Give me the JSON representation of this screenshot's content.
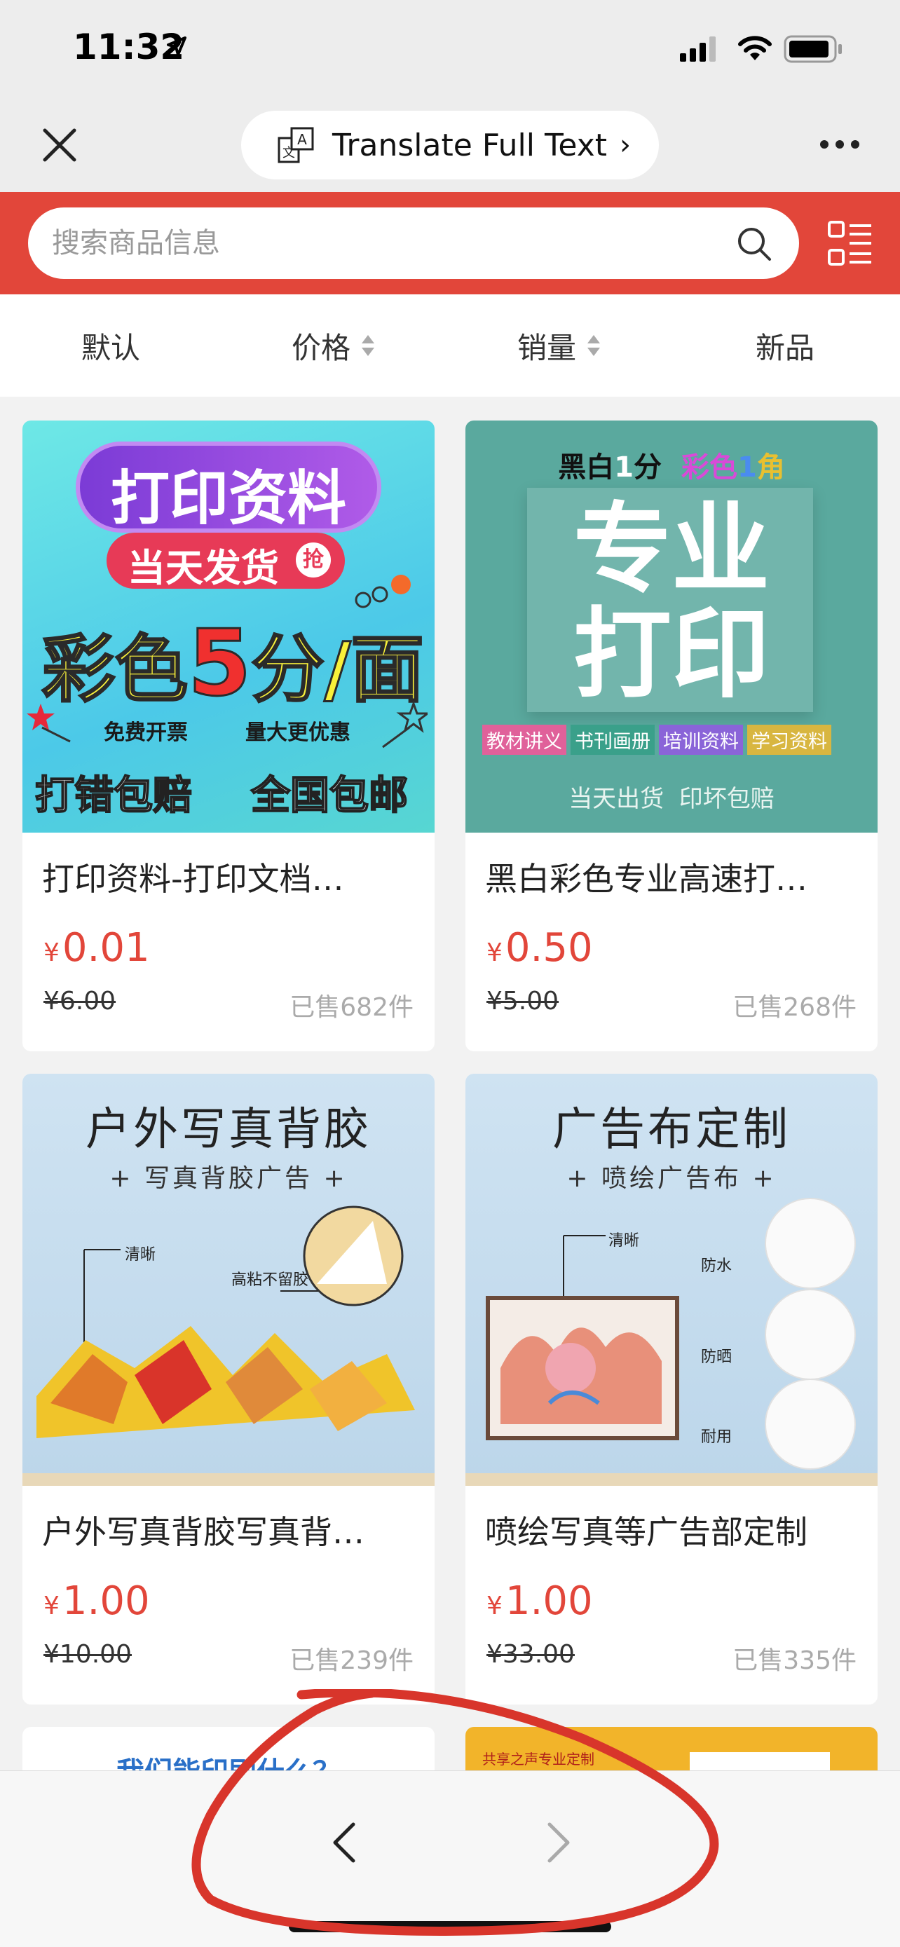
{
  "status_bar": {
    "time": "11:32"
  },
  "nav": {
    "translate_label": "Translate Full Text",
    "translate_chevron": "›"
  },
  "search": {
    "placeholder": "搜索商品信息"
  },
  "sort": {
    "default": "默认",
    "price": "价格",
    "sales": "销量",
    "new": "新品"
  },
  "products": [
    {
      "title": "打印资料-打印文档…",
      "price": "0.01",
      "orig": "¥6.00",
      "sold": "已售682件",
      "img": {
        "l1": "打印资料",
        "l2": "当天发货",
        "badge": "抢",
        "l3a": "彩色",
        "l3b": "5",
        "l3c": "分/面",
        "l4a": "免费开票",
        "l4b": "量大更优惠",
        "l5a": "打错包赔",
        "l5b": "全国包邮"
      }
    },
    {
      "title": "黑白彩色专业高速打…",
      "price": "0.50",
      "orig": "¥5.00",
      "sold": "已售268件",
      "img": {
        "top_a": "黑白",
        "top_b": "1",
        "top_c": "分",
        "top_d": "彩色",
        "top_e": "1",
        "top_f": "角",
        "l1": "专业",
        "l2": "打印",
        "tags": [
          "教材讲义",
          "书刊画册",
          "培训资料",
          "学习资料"
        ],
        "bottom": "当天出货  印坏包赔"
      }
    },
    {
      "title": "户外写真背胶写真背…",
      "price": "1.00",
      "orig": "¥10.00",
      "sold": "已售239件",
      "img": {
        "l1": "户外写真背胶",
        "l2": "+ 写真背胶广告 +",
        "c1": "清晰",
        "c2": "高粘不留胶"
      }
    },
    {
      "title": "喷绘写真等广告部定制",
      "price": "1.00",
      "orig": "¥33.00",
      "sold": "已售335件",
      "img": {
        "l1": "广告布定制",
        "l2": "+ 喷绘广告布 +",
        "c1": "清晰",
        "c2": "防水",
        "c3": "防晒",
        "c4": "耐用"
      }
    }
  ],
  "partial": {
    "left_text": "我们能印刷什么？",
    "right_text": "共享之声专业定制"
  },
  "colors": {
    "accent": "#e2463a",
    "price": "#e2463a"
  }
}
